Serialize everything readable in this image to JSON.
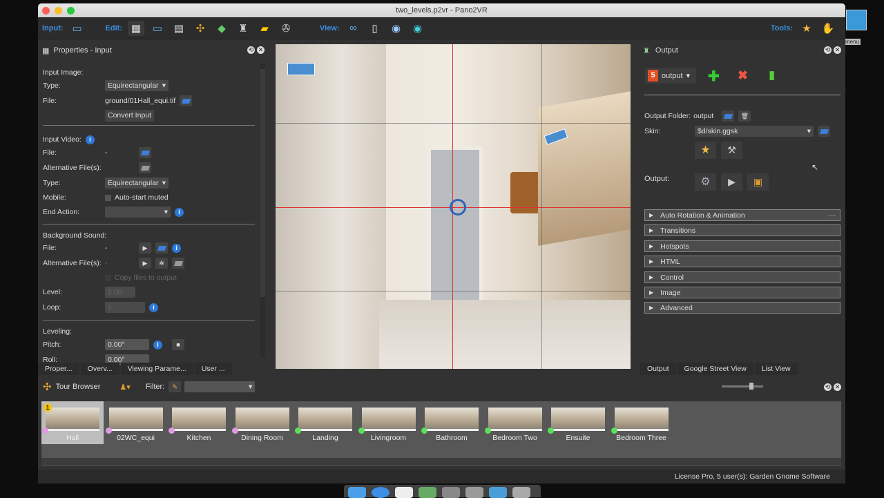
{
  "window": {
    "title": "two_levels.p2vr - Pano2VR"
  },
  "toolbar": {
    "input_label": "Input:",
    "edit_label": "Edit:",
    "view_label": "View:",
    "tools_label": "Tools:",
    "input_icons": [
      "panorama-add-icon"
    ],
    "edit_icons": [
      "properties-icon",
      "viewing-parameters-icon",
      "user-data-icon",
      "tour-browser-icon",
      "tour-map-icon",
      "output-icon",
      "google-street-view-icon",
      "animation-icon"
    ],
    "view_icons": [
      "binoculars-icon",
      "list-view-icon",
      "compass-icon",
      "eye-icon"
    ],
    "tools_icons": [
      "skin-editor-icon",
      "hand-icon"
    ]
  },
  "desktop": {
    "menu_label": "menu"
  },
  "properties": {
    "title": "Properties - Input",
    "input_image_label": "Input Image:",
    "type_label": "Type:",
    "type_value": "Equirectangular",
    "file_label": "File:",
    "file_value": "ground/01Hall_equi.tif",
    "convert_button": "Convert Input",
    "input_video_label": "Input Video:",
    "video_file_label": "File:",
    "video_file_value": "-",
    "alt_files_label": "Alternative File(s):",
    "alt_files_value": "-",
    "video_type_label": "Type:",
    "video_type_value": "Equirectangular",
    "mobile_label": "Mobile:",
    "autostart_label": "Auto-start muted",
    "autostart_checked": false,
    "end_action_label": "End Action:",
    "end_action_value": "",
    "bg_sound_label": "Background Sound:",
    "sound_file_label": "File:",
    "sound_file_value": "-",
    "sound_alt_label": "Alternative File(s):",
    "sound_alt_value": "-",
    "copy_files_label": "Copy files to output",
    "level_label": "Level:",
    "level_value": "1.00",
    "loop_label": "Loop:",
    "loop_value": "1",
    "leveling_label": "Leveling:",
    "pitch_label": "Pitch:",
    "pitch_value": "0.00°",
    "roll_label": "Roll:",
    "roll_value": "0.00°",
    "tabs": [
      "Proper...",
      "Overv...",
      "Viewing Parame...",
      "User ..."
    ]
  },
  "output": {
    "title": "Output",
    "format_value": "output",
    "folder_label": "Output Folder:",
    "folder_value": "output",
    "skin_label": "Skin:",
    "skin_value": "$d/skin.ggsk",
    "output_label": "Output:",
    "sections": [
      "Auto Rotation & Animation",
      "Transitions",
      "Hotspots",
      "HTML",
      "Control",
      "Image",
      "Advanced"
    ],
    "tabs": [
      "Output",
      "Google Street View",
      "List View"
    ]
  },
  "tour": {
    "title": "Tour Browser",
    "filter_label": "Filter:",
    "filter_value": "",
    "start_badge": "1",
    "nodes": [
      {
        "name": "Hall",
        "color": "#e09be0",
        "selected": true
      },
      {
        "name": "02WC_equi",
        "color": "#e09be0"
      },
      {
        "name": "Kitchen",
        "color": "#e09be0"
      },
      {
        "name": "Dining Room",
        "color": "#e09be0"
      },
      {
        "name": "Landing",
        "color": "#5be05b"
      },
      {
        "name": "Livingroom",
        "color": "#5be05b"
      },
      {
        "name": "Bathroom",
        "color": "#5be05b"
      },
      {
        "name": "Bedroom Two",
        "color": "#5be05b"
      },
      {
        "name": "Ensuite",
        "color": "#5be05b"
      },
      {
        "name": "Bedroom Three",
        "color": "#5be05b"
      }
    ]
  },
  "status": {
    "license": "License Pro, 5 user(s): Garden Gnome Software"
  },
  "colors": {
    "accent": "#3c8fe0",
    "panel": "#323232",
    "crosshair": "#e03030"
  }
}
